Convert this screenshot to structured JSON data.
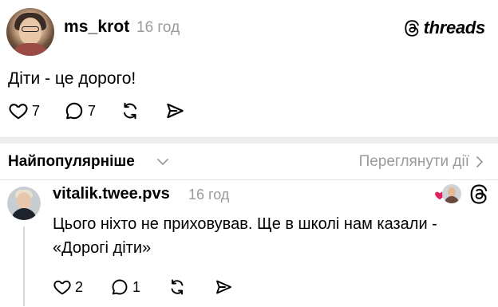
{
  "post": {
    "username": "ms_krot",
    "time": "16 год",
    "brand": "threads",
    "text": "Діти - це дорого!",
    "likes": "7",
    "replies": "7"
  },
  "bar": {
    "sort_label": "Найпопулярніше",
    "activity_link": "Переглянути дії"
  },
  "reply": {
    "username": "vitalik.twee.pvs",
    "time": "16 год",
    "text": "Цього ніхто не приховував. Ще в школі нам казали - «Дорогі діти»",
    "likes": "2",
    "replies": "1"
  },
  "colors": {
    "text": "#000000",
    "muted": "#9a9a9a",
    "heart": "#e0245e",
    "divider": "#eceef0"
  }
}
